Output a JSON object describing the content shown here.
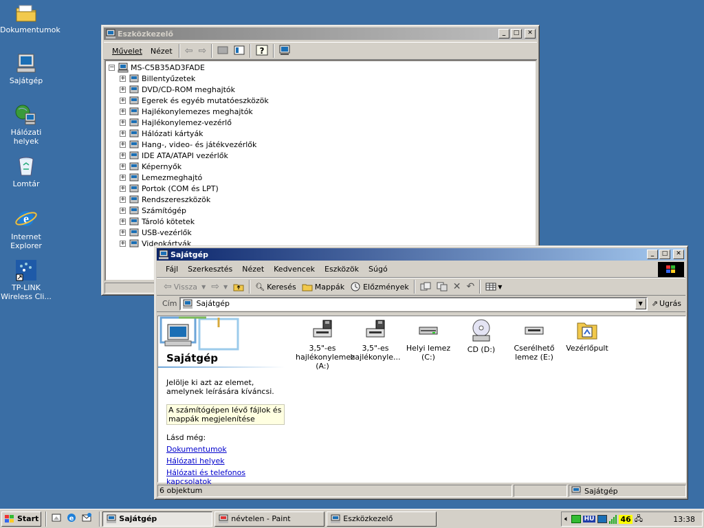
{
  "desktop": {
    "icons": [
      {
        "label": "Dokumentumok"
      },
      {
        "label": "Sajátgép"
      },
      {
        "label": "Hálózati helyek"
      },
      {
        "label": "Lomtár"
      },
      {
        "label": "Internet Explorer"
      },
      {
        "label": "TP-LINK Wireless Cli..."
      }
    ]
  },
  "devmgr": {
    "title": "Eszközkezelő",
    "menu": [
      "Művelet",
      "Nézet"
    ],
    "root": "MS-C5B35AD3FADE",
    "items": [
      "Billentyűzetek",
      "DVD/CD-ROM meghajtók",
      "Egerek és egyéb mutatóeszközök",
      "Hajlékonylemezes meghajtók",
      "Hajlékonylemez-vezérlő",
      "Hálózati kártyák",
      "Hang-, video- és játékvezérlők",
      "IDE ATA/ATAPI vezérlők",
      "Képernyők",
      "Lemezmeghajtó",
      "Portok (COM és LPT)",
      "Rendszereszközök",
      "Számítógép",
      "Tároló kötetek",
      "USB-vezérlők",
      "Videokártyák"
    ]
  },
  "explorer": {
    "title": "Sajátgép",
    "menu": [
      "Fájl",
      "Szerkesztés",
      "Nézet",
      "Kedvencek",
      "Eszközök",
      "Súgó"
    ],
    "toolbar": {
      "back": "Vissza",
      "search": "Keresés",
      "folders": "Mappák",
      "history": "Előzmények"
    },
    "address": {
      "label": "Cím",
      "value": "Sajátgép",
      "go": "Ugrás"
    },
    "panel": {
      "title": "Sajátgép",
      "desc": "Jelölje ki azt az elemet, amelynek leírására kíváncsi.",
      "tip": "A számítógépen lévő fájlok és mappák megjelenítése",
      "see_also": "Lásd még:",
      "links": [
        "Dokumentumok",
        "Hálózati helyek",
        "Hálózati és telefonos kapcsolatok"
      ]
    },
    "files": [
      {
        "label": "3,5\"-es hajlékonylemez (A:)",
        "icon": "floppy-drive-icon"
      },
      {
        "label": "3,5\"-es hajlékonyle...",
        "icon": "floppy-drive-icon"
      },
      {
        "label": "Helyi lemez (C:)",
        "icon": "hard-disk-icon"
      },
      {
        "label": "CD (D:)",
        "icon": "cd-drive-icon"
      },
      {
        "label": "Cserélhető lemez (E:)",
        "icon": "removable-disk-icon"
      },
      {
        "label": "Vezérlőpult",
        "icon": "control-panel-icon"
      }
    ],
    "status": {
      "count": "6 objektum",
      "zone": "Sajátgép"
    }
  },
  "taskbar": {
    "start": "Start",
    "buttons": [
      "Sajátgép",
      "névtelen - Paint",
      "Eszközkezelő"
    ],
    "lang": "HU",
    "num": "46",
    "clock": "13:38"
  }
}
